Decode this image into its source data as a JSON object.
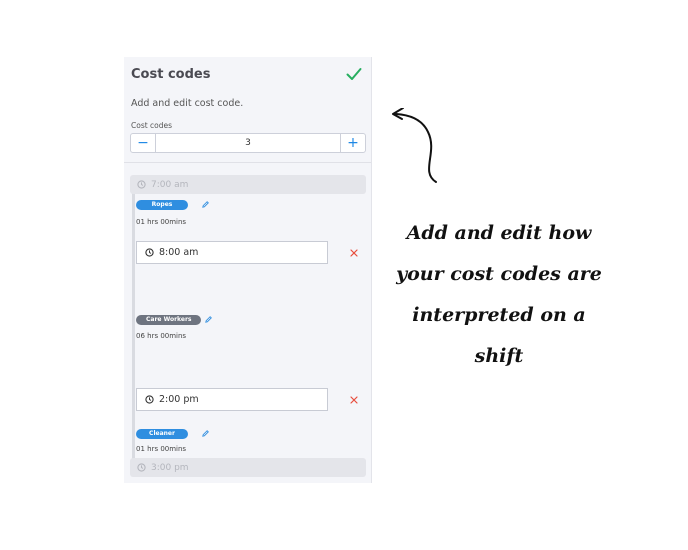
{
  "panel": {
    "title": "Cost codes",
    "description": "Add and edit cost code.",
    "cost_codes_label": "Cost codes",
    "stepper": {
      "minus": "−",
      "value": "3",
      "plus": "+"
    }
  },
  "timeline": {
    "start_time": "7:00 am",
    "end_time": "3:00 pm",
    "entries": [
      {
        "tag": "Ropes",
        "tag_color": "#2f8ee0",
        "duration": "01 hrs 00mins"
      },
      {
        "time": "8:00 am",
        "tag": "Care Workers",
        "tag_color": "#6e7480",
        "duration": "06 hrs 00mins"
      },
      {
        "time": "2:00 pm",
        "tag": "Cleaner",
        "tag_color": "#2f8ee0",
        "duration": "01 hrs 00mins"
      }
    ]
  },
  "annotation": {
    "lines": [
      "Add and edit how",
      "your cost codes are",
      "interpreted on a",
      "shift"
    ]
  },
  "colors": {
    "accent": "#2f8ee0",
    "success": "#27ae60",
    "danger": "#e74c3c"
  }
}
